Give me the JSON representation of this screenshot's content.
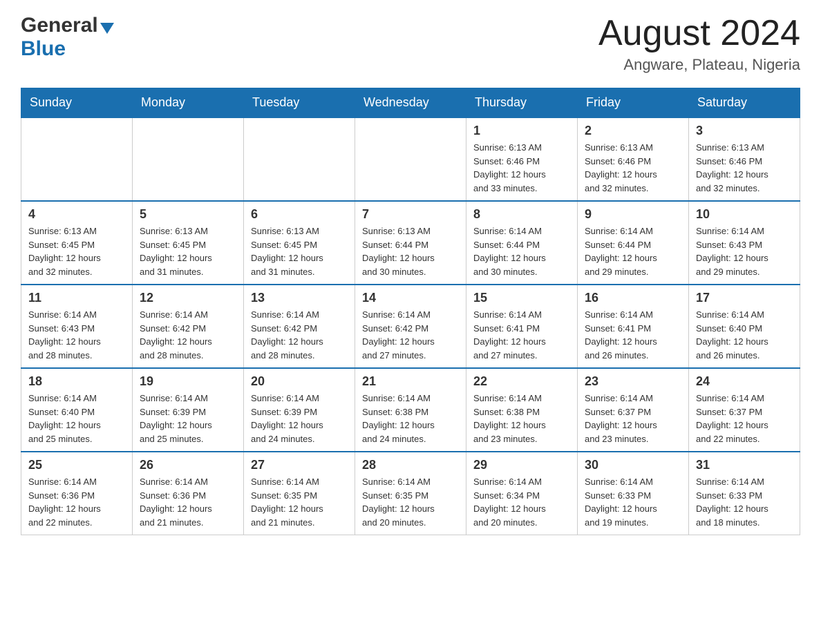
{
  "header": {
    "logo": {
      "general": "General",
      "blue": "Blue"
    },
    "title": "August 2024",
    "location": "Angware, Plateau, Nigeria"
  },
  "calendar": {
    "days_of_week": [
      "Sunday",
      "Monday",
      "Tuesday",
      "Wednesday",
      "Thursday",
      "Friday",
      "Saturday"
    ],
    "weeks": [
      {
        "days": [
          {
            "number": "",
            "info": ""
          },
          {
            "number": "",
            "info": ""
          },
          {
            "number": "",
            "info": ""
          },
          {
            "number": "",
            "info": ""
          },
          {
            "number": "1",
            "info": "Sunrise: 6:13 AM\nSunset: 6:46 PM\nDaylight: 12 hours\nand 33 minutes."
          },
          {
            "number": "2",
            "info": "Sunrise: 6:13 AM\nSunset: 6:46 PM\nDaylight: 12 hours\nand 32 minutes."
          },
          {
            "number": "3",
            "info": "Sunrise: 6:13 AM\nSunset: 6:46 PM\nDaylight: 12 hours\nand 32 minutes."
          }
        ]
      },
      {
        "days": [
          {
            "number": "4",
            "info": "Sunrise: 6:13 AM\nSunset: 6:45 PM\nDaylight: 12 hours\nand 32 minutes."
          },
          {
            "number": "5",
            "info": "Sunrise: 6:13 AM\nSunset: 6:45 PM\nDaylight: 12 hours\nand 31 minutes."
          },
          {
            "number": "6",
            "info": "Sunrise: 6:13 AM\nSunset: 6:45 PM\nDaylight: 12 hours\nand 31 minutes."
          },
          {
            "number": "7",
            "info": "Sunrise: 6:13 AM\nSunset: 6:44 PM\nDaylight: 12 hours\nand 30 minutes."
          },
          {
            "number": "8",
            "info": "Sunrise: 6:14 AM\nSunset: 6:44 PM\nDaylight: 12 hours\nand 30 minutes."
          },
          {
            "number": "9",
            "info": "Sunrise: 6:14 AM\nSunset: 6:44 PM\nDaylight: 12 hours\nand 29 minutes."
          },
          {
            "number": "10",
            "info": "Sunrise: 6:14 AM\nSunset: 6:43 PM\nDaylight: 12 hours\nand 29 minutes."
          }
        ]
      },
      {
        "days": [
          {
            "number": "11",
            "info": "Sunrise: 6:14 AM\nSunset: 6:43 PM\nDaylight: 12 hours\nand 28 minutes."
          },
          {
            "number": "12",
            "info": "Sunrise: 6:14 AM\nSunset: 6:42 PM\nDaylight: 12 hours\nand 28 minutes."
          },
          {
            "number": "13",
            "info": "Sunrise: 6:14 AM\nSunset: 6:42 PM\nDaylight: 12 hours\nand 28 minutes."
          },
          {
            "number": "14",
            "info": "Sunrise: 6:14 AM\nSunset: 6:42 PM\nDaylight: 12 hours\nand 27 minutes."
          },
          {
            "number": "15",
            "info": "Sunrise: 6:14 AM\nSunset: 6:41 PM\nDaylight: 12 hours\nand 27 minutes."
          },
          {
            "number": "16",
            "info": "Sunrise: 6:14 AM\nSunset: 6:41 PM\nDaylight: 12 hours\nand 26 minutes."
          },
          {
            "number": "17",
            "info": "Sunrise: 6:14 AM\nSunset: 6:40 PM\nDaylight: 12 hours\nand 26 minutes."
          }
        ]
      },
      {
        "days": [
          {
            "number": "18",
            "info": "Sunrise: 6:14 AM\nSunset: 6:40 PM\nDaylight: 12 hours\nand 25 minutes."
          },
          {
            "number": "19",
            "info": "Sunrise: 6:14 AM\nSunset: 6:39 PM\nDaylight: 12 hours\nand 25 minutes."
          },
          {
            "number": "20",
            "info": "Sunrise: 6:14 AM\nSunset: 6:39 PM\nDaylight: 12 hours\nand 24 minutes."
          },
          {
            "number": "21",
            "info": "Sunrise: 6:14 AM\nSunset: 6:38 PM\nDaylight: 12 hours\nand 24 minutes."
          },
          {
            "number": "22",
            "info": "Sunrise: 6:14 AM\nSunset: 6:38 PM\nDaylight: 12 hours\nand 23 minutes."
          },
          {
            "number": "23",
            "info": "Sunrise: 6:14 AM\nSunset: 6:37 PM\nDaylight: 12 hours\nand 23 minutes."
          },
          {
            "number": "24",
            "info": "Sunrise: 6:14 AM\nSunset: 6:37 PM\nDaylight: 12 hours\nand 22 minutes."
          }
        ]
      },
      {
        "days": [
          {
            "number": "25",
            "info": "Sunrise: 6:14 AM\nSunset: 6:36 PM\nDaylight: 12 hours\nand 22 minutes."
          },
          {
            "number": "26",
            "info": "Sunrise: 6:14 AM\nSunset: 6:36 PM\nDaylight: 12 hours\nand 21 minutes."
          },
          {
            "number": "27",
            "info": "Sunrise: 6:14 AM\nSunset: 6:35 PM\nDaylight: 12 hours\nand 21 minutes."
          },
          {
            "number": "28",
            "info": "Sunrise: 6:14 AM\nSunset: 6:35 PM\nDaylight: 12 hours\nand 20 minutes."
          },
          {
            "number": "29",
            "info": "Sunrise: 6:14 AM\nSunset: 6:34 PM\nDaylight: 12 hours\nand 20 minutes."
          },
          {
            "number": "30",
            "info": "Sunrise: 6:14 AM\nSunset: 6:33 PM\nDaylight: 12 hours\nand 19 minutes."
          },
          {
            "number": "31",
            "info": "Sunrise: 6:14 AM\nSunset: 6:33 PM\nDaylight: 12 hours\nand 18 minutes."
          }
        ]
      }
    ]
  }
}
